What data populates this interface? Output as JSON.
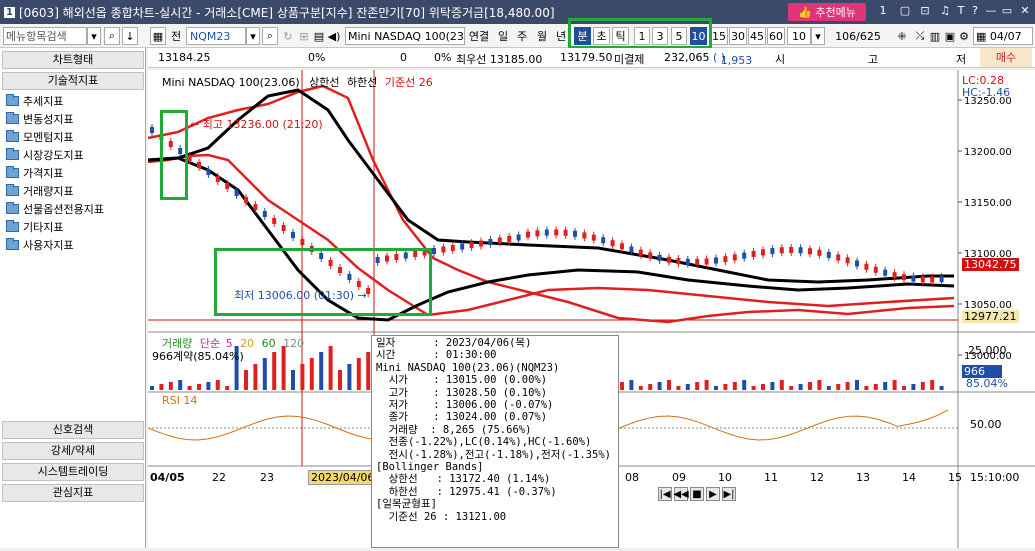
{
  "title": {
    "num": "1",
    "text": "[0603] 해외선옵 종합차트-실시간 - 거래소[CME] 상품구분[지수] 잔존만기[70] 위탁증거금[18,480.00]",
    "rec_menu": "추천메뉴",
    "ctrls": [
      "1",
      "▢",
      "⊡",
      "♫",
      "T",
      "?",
      "—",
      "▭",
      "✕"
    ]
  },
  "toolbar": {
    "menu_search": "메뉴항목검색",
    "all_label": "전",
    "symbol": "NQM23",
    "product": "Mini NASDAQ 100(23.0",
    "link": "연결",
    "day": "일",
    "week": "주",
    "month": "월",
    "year": "년",
    "min": "분",
    "sec": "초",
    "tick": "틱",
    "intervals": [
      "1",
      "3",
      "5",
      "10",
      "15",
      "30",
      "45",
      "60"
    ],
    "interval_sel": "10",
    "count": "106/625",
    "date": "04/07"
  },
  "infobar": {
    "price": "13184.25",
    "pct1": "0%",
    "vol": "0",
    "pct2": "0%",
    "best_sell": "최우선 13185.00",
    "best_buy": "13179.50",
    "open_int_label": "미결제",
    "open_int": "232,065",
    "oi_change": "1,953",
    "market": "시",
    "high_low": "고",
    "low": "저",
    "sell": "매수"
  },
  "sidebar": {
    "header1": "차트형태",
    "header2": "기술적지표",
    "items": [
      "추세지표",
      "변동성지표",
      "모멘텀지표",
      "시장강도지표",
      "가격지표",
      "거래량지표",
      "선물옵션전용지표",
      "기타지표",
      "사용자지표"
    ],
    "bottom": [
      "신호검색",
      "강세/약세",
      "시스템트레이딩",
      "관심지표"
    ]
  },
  "legend": {
    "main": "Mini NASDAQ 100(23.06)",
    "upper": "상한선",
    "lower": "하한선",
    "base": "기준선 26",
    "lc": "LC:0.28",
    "hc": "HC:-1.46",
    "volume": "거래량",
    "simple": "단순",
    "ma": [
      "5",
      "20",
      "60",
      "120"
    ],
    "vol_text": "966계약(85.04%)",
    "rsi": "RSI 14",
    "high_note": "최고 13236.00 (21:20)",
    "low_note": "최저 13006.00 (01:30)"
  },
  "axis": {
    "price_ticks": [
      "13250.00",
      "13200.00",
      "13150.00",
      "13100.00",
      "13050.00",
      "13000.00"
    ],
    "current_price": "13042.75",
    "line_price": "12977.21",
    "vol_tick": "25,000",
    "vol_val": "966",
    "vol_pct": "85.04%",
    "rsi_tick": "50.00",
    "time": "15:10:00",
    "x_labels": [
      "04/05",
      "22",
      "23",
      "08",
      "09",
      "10",
      "11",
      "12",
      "13",
      "14",
      "15"
    ],
    "cursor_date": "2023/04/06"
  },
  "tooltip": [
    "일자      : 2023/04/06(목)",
    "시간      : 01:30:00",
    "Mini NASDAQ 100(23.06)(NQM23)",
    "  시가    : 13015.00 (0.00%)",
    "  고가    : 13028.50 (0.10%)",
    "  저가    : 13006.00 (-0.07%)",
    "  종가    : 13024.00 (0.07%)",
    "  거래량  : 8,265 (75.66%)",
    "  전종(-1.22%),LC(0.14%),HC(-1.60%)",
    "  전시(-1.28%),전고(-1.18%),전저(-1.35%)",
    "[Bollinger Bands]",
    "  상한선   : 13172.40 (1.14%)",
    "  하한선   : 12975.41 (-0.37%)",
    "[일목균형표]",
    "  기준선 26 : 13121.00"
  ],
  "colors": {
    "title_bg": "#3b4a6b",
    "accent": "#1f4e9a",
    "green": "#22a93a",
    "up": "#e0201e",
    "down": "#1f4ea8"
  }
}
